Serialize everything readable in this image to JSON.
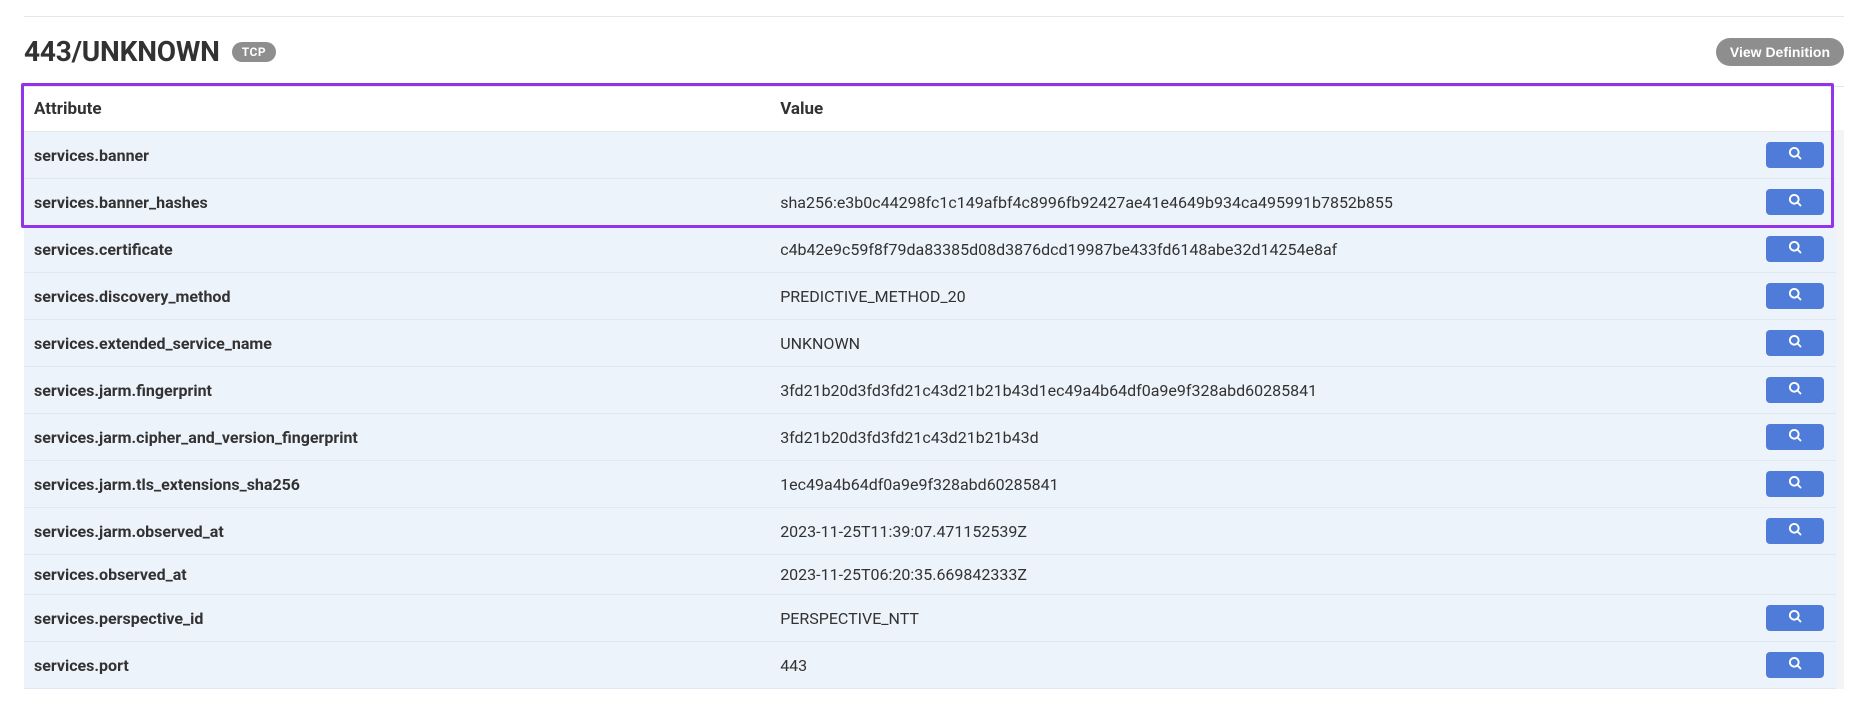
{
  "header": {
    "title": "443/UNKNOWN",
    "badge": "TCP",
    "view_definition_label": "View Definition"
  },
  "table": {
    "columns": {
      "attribute": "Attribute",
      "value": "Value"
    },
    "rows": [
      {
        "attr": "services.banner",
        "val": "",
        "search": true
      },
      {
        "attr": "services.banner_hashes",
        "val": "sha256:e3b0c44298fc1c149afbf4c8996fb92427ae41e4649b934ca495991b7852b855",
        "search": true
      },
      {
        "attr": "services.certificate",
        "val": "c4b42e9c59f8f79da83385d08d3876dcd19987be433fd6148abe32d14254e8af",
        "search": true
      },
      {
        "attr": "services.discovery_method",
        "val": "PREDICTIVE_METHOD_20",
        "search": true
      },
      {
        "attr": "services.extended_service_name",
        "val": "UNKNOWN",
        "search": true
      },
      {
        "attr": "services.jarm.fingerprint",
        "val": "3fd21b20d3fd3fd21c43d21b21b43d1ec49a4b64df0a9e9f328abd60285841",
        "search": true
      },
      {
        "attr": "services.jarm.cipher_and_version_fingerprint",
        "val": "3fd21b20d3fd3fd21c43d21b21b43d",
        "search": true
      },
      {
        "attr": "services.jarm.tls_extensions_sha256",
        "val": "1ec49a4b64df0a9e9f328abd60285841",
        "search": true
      },
      {
        "attr": "services.jarm.observed_at",
        "val": "2023-11-25T11:39:07.471152539Z",
        "search": true
      },
      {
        "attr": "services.observed_at",
        "val": "2023-11-25T06:20:35.669842333Z",
        "search": false
      },
      {
        "attr": "services.perspective_id",
        "val": "PERSPECTIVE_NTT",
        "search": true
      },
      {
        "attr": "services.port",
        "val": "443",
        "search": true
      }
    ]
  },
  "highlight": {
    "top": 0,
    "left": 0,
    "height_rows": 3
  }
}
